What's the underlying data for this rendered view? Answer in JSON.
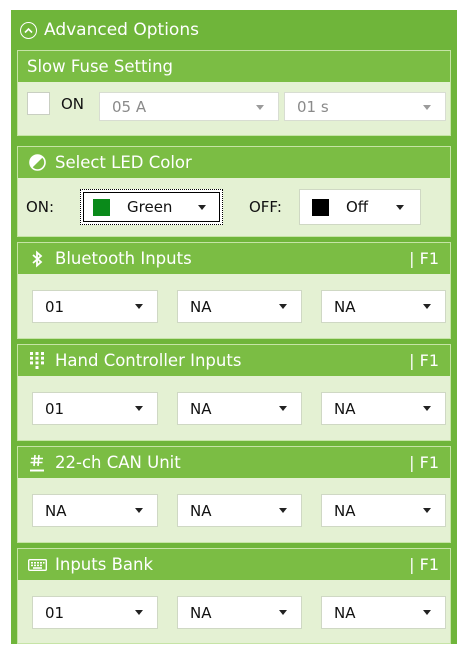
{
  "panel": {
    "title": "Advanced Options"
  },
  "slow_fuse": {
    "title": "Slow Fuse Setting",
    "on_label": "ON",
    "current_value": "05 A",
    "time_value": "01 s"
  },
  "led": {
    "title": "Select LED Color",
    "on_label": "ON:",
    "on_value": "Green",
    "on_color": "#0a8a1a",
    "off_label": "OFF:",
    "off_value": "Off",
    "off_color": "#000000"
  },
  "bluetooth": {
    "title": "Bluetooth Inputs",
    "tag": "| F1",
    "values": [
      "01",
      "NA",
      "NA"
    ]
  },
  "hand_controller": {
    "title": "Hand Controller Inputs",
    "tag": "| F1",
    "values": [
      "01",
      "NA",
      "NA"
    ]
  },
  "can_unit": {
    "title": "22-ch CAN Unit",
    "tag": "| F1",
    "values": [
      "NA",
      "NA",
      "NA"
    ]
  },
  "inputs_bank": {
    "title": "Inputs Bank",
    "tag": "| F1",
    "values": [
      "01",
      "NA",
      "NA"
    ]
  }
}
